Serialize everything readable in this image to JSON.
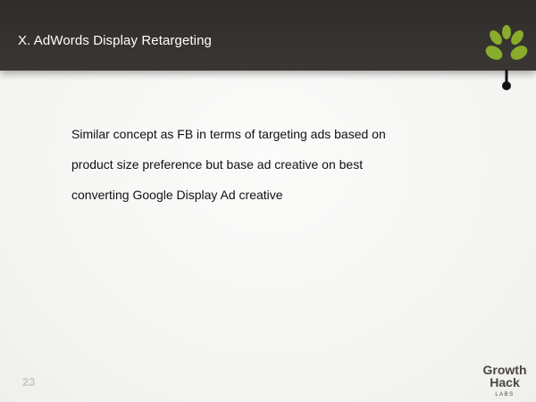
{
  "slide": {
    "title": "X. AdWords Display Retargeting",
    "body_lines": [
      "Similar concept as FB in terms of targeting ads based on",
      "product size preference but base ad creative on best",
      "converting Google Display Ad creative"
    ],
    "page_number": "23"
  },
  "branding": {
    "sprout_icon": "plant-sprout-icon",
    "logo_text": "Growth Hack LABS",
    "leaf_color": "#8aac2c",
    "stem_color": "#111111",
    "logo_text_color": "#4a4541"
  }
}
